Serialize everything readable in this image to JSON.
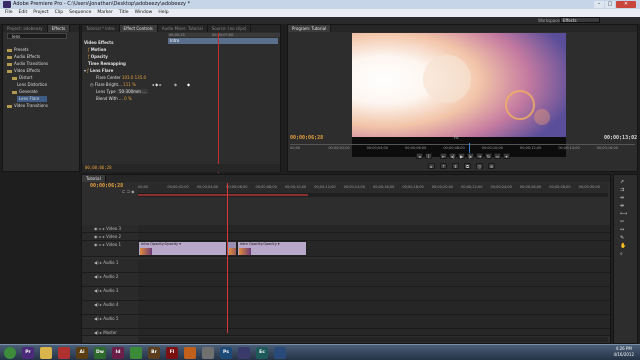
{
  "window": {
    "title": "Adobe Premiere Pro - C:\\Users\\Jonathan\\Desktop\\adobeezy\\adobeezy *",
    "minimize": "–",
    "maximize": "□",
    "close": "✕"
  },
  "menu": [
    "File",
    "Edit",
    "Project",
    "Clip",
    "Sequence",
    "Marker",
    "Title",
    "Window",
    "Help"
  ],
  "workspace": {
    "label": "Workspace:",
    "value": "Effects"
  },
  "effects_panel": {
    "tabs": [
      "Project: adobeezy",
      "Effects"
    ],
    "search_value": "lens",
    "items": [
      {
        "label": "Presets",
        "type": "folder"
      },
      {
        "label": "Audio Effects",
        "type": "folder"
      },
      {
        "label": "Audio Transitions",
        "type": "folder"
      },
      {
        "label": "Video Effects",
        "type": "folder"
      },
      {
        "label": "Distort",
        "type": "folder"
      },
      {
        "label": "Lens Distortion",
        "type": "effect"
      },
      {
        "label": "Generate",
        "type": "folder"
      },
      {
        "label": "Lens Flare",
        "type": "effect",
        "selected": true
      },
      {
        "label": "Video Transitions",
        "type": "folder"
      }
    ]
  },
  "effect_controls": {
    "tabs": [
      "Tutorial * Intro",
      "Effect Controls",
      "Audio Mixer: Tutorial",
      "Source: (no clips)"
    ],
    "clip_name": "Intro",
    "mini_ruler": [
      "00;00;15",
      "00;00;07;00"
    ],
    "section": "Video Effects",
    "rows": [
      {
        "label": "Motion",
        "kind": "fx"
      },
      {
        "label": "Opacity",
        "kind": "fx"
      },
      {
        "label": "Time Remapping",
        "kind": "fx"
      },
      {
        "label": "Lens Flare",
        "kind": "fx"
      },
      {
        "label": "Flare Center",
        "value": "103.0    135.0"
      },
      {
        "label": "Flare Bright...",
        "value": "111 %"
      },
      {
        "label": "Lens Type",
        "value": "50-300mm ..."
      },
      {
        "label": "Blend With ...",
        "value": "0 %"
      }
    ],
    "timecode": "00;00;06;28"
  },
  "program_monitor": {
    "tabs": [
      "Program: Tutorial"
    ],
    "timecode_current": "00;00;06;28",
    "timecode_total": "00;00;13;02",
    "fit": "Fit",
    "ruler": [
      "00;00",
      "00;00;02;00",
      "00;00;04;00",
      "00;00;06;00",
      "00;00;08;00",
      "00;00;10;00",
      "00;00;12;00",
      "00;00;14;00",
      "00;00;16;00"
    ],
    "playhead": 0.52
  },
  "timeline": {
    "tab": "Tutorial",
    "timecode": "00;00;06;28",
    "ruler": [
      "00;00",
      "00;00;02;00",
      "00;00;04;00",
      "00;00;06;00",
      "00;00;08;00",
      "00;00;10;00",
      "00;00;12;00",
      "00;00;14;00",
      "00;00;16;00",
      "00;00;18;00",
      "00;00;20;00",
      "00;00;22;00",
      "00;00;24;00",
      "00;00;26;00",
      "00;00;28;00",
      "00;00;30;00"
    ],
    "playhead": 0.19,
    "video_tracks": [
      "Video 3",
      "Video 2",
      "Video 1"
    ],
    "audio_tracks": [
      "Audio 1",
      "Audio 2",
      "Audio 3",
      "Audio 4",
      "Audio 5",
      "Master"
    ],
    "clips": [
      {
        "label": "Intro  Opacity:Opacity ▾",
        "start": 0.0,
        "end": 0.19,
        "track": "Video 1",
        "color": "#b7a7c9"
      },
      {
        "label": "",
        "start": 0.19,
        "end": 0.21,
        "track": "Video 1",
        "color": "#9a8fb0"
      },
      {
        "label": "Intro  Opacity:Opacity ▾",
        "start": 0.21,
        "end": 0.36,
        "track": "Video 1",
        "color": "#b7a7c9"
      }
    ]
  },
  "taskbar": {
    "apps": [
      {
        "name": "windows-start",
        "label": "",
        "color": "#3c8c3c"
      },
      {
        "name": "premiere",
        "label": "Pr",
        "color": "#4b2a7a"
      },
      {
        "name": "explorer",
        "label": "",
        "color": "#d9b44a"
      },
      {
        "name": "acrobat",
        "label": "",
        "color": "#b03030"
      },
      {
        "name": "illustrator",
        "label": "Ai",
        "color": "#5a3e12"
      },
      {
        "name": "dreamweaver",
        "label": "Dw",
        "color": "#2e6a2e"
      },
      {
        "name": "indesign",
        "label": "Id",
        "color": "#6a1e48"
      },
      {
        "name": "chrome",
        "label": "",
        "color": "#3a8a3a"
      },
      {
        "name": "bridge",
        "label": "Br",
        "color": "#5a3e1e"
      },
      {
        "name": "flash",
        "label": "Fl",
        "color": "#7a1010"
      },
      {
        "name": "firefox",
        "label": "",
        "color": "#c0601a"
      },
      {
        "name": "app-gray",
        "label": "",
        "color": "#707070"
      },
      {
        "name": "photoshop",
        "label": "Ps",
        "color": "#1e4a7a"
      },
      {
        "name": "after-effects",
        "label": "",
        "color": "#3a3a6a"
      },
      {
        "name": "encore",
        "label": "Ec",
        "color": "#1e5a5a"
      },
      {
        "name": "explorer2",
        "label": "",
        "color": "#2a4a7a"
      }
    ],
    "time": "4:26 PM",
    "date": "4/16/2012"
  }
}
